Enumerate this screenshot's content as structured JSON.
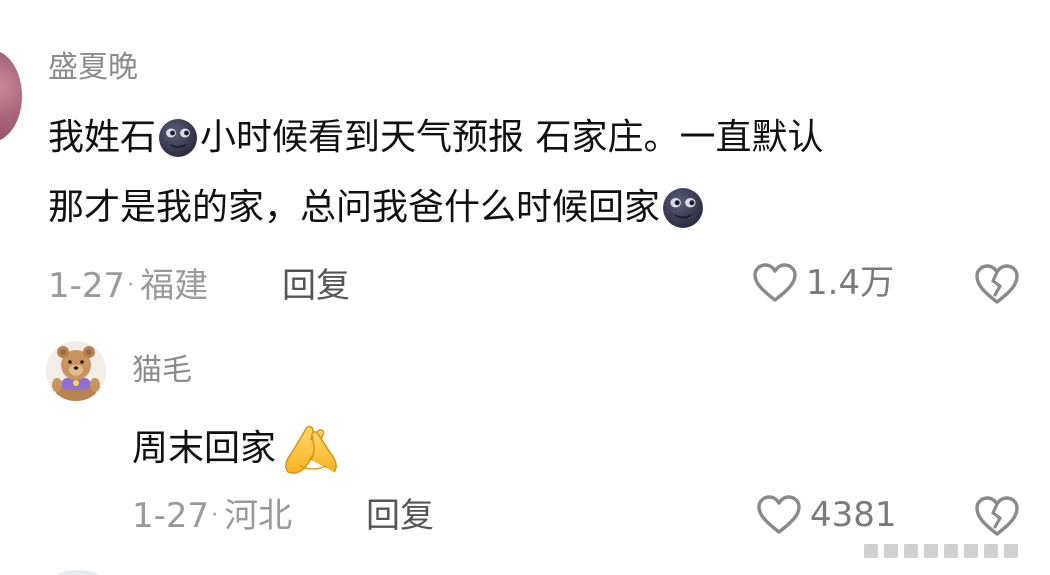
{
  "comment": {
    "username": "盛夏晚",
    "text_line1_before_emoji": "我姓石",
    "text_line1_after_emoji": "小时候看到天气预报 石家庄。一直默认",
    "text_line2": "那才是我的家，总问我爸什么时候回家",
    "emoji_icon": "new-moon-face-icon",
    "date": "1-27",
    "dot": "·",
    "location": "福建",
    "reply_label": "回复",
    "like_count": "1.4万"
  },
  "reply": {
    "username": "猫毛",
    "text": "周末回家",
    "emoji_icon": "folded-hands-icon",
    "date": "1-27",
    "dot": "·",
    "location": "河北",
    "reply_label": "回复",
    "like_count": "4381"
  },
  "colors": {
    "username": "#8c8c8c",
    "text": "#111111",
    "meta": "#9a9a9a",
    "reply": "#555555",
    "icon": "#8a8a8a"
  }
}
